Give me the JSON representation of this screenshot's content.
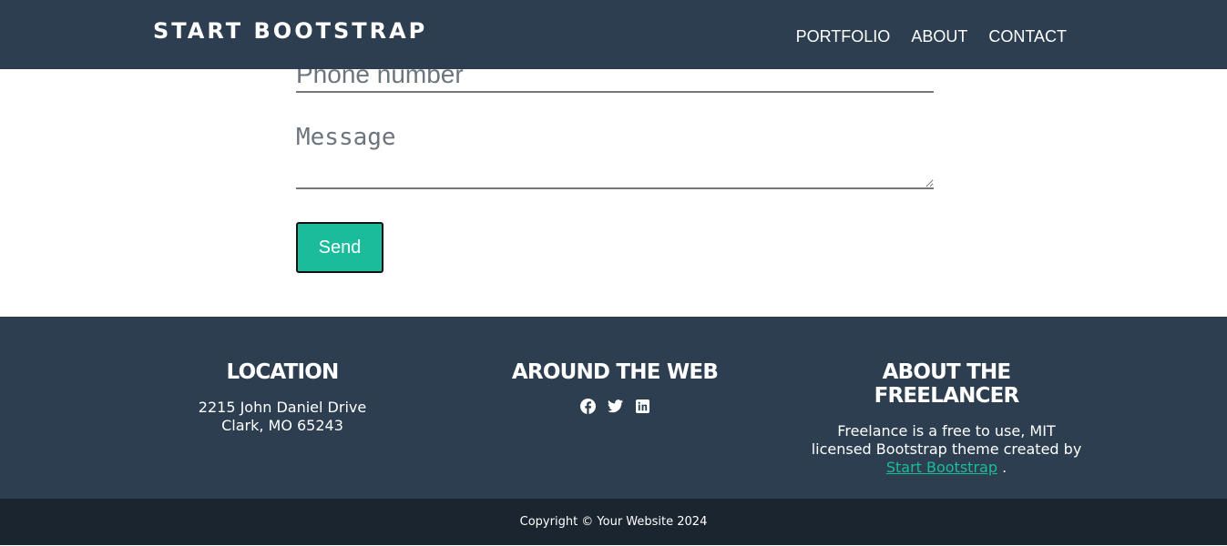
{
  "navbar": {
    "brand": "START BOOTSTRAP",
    "links": [
      "PORTFOLIO",
      "ABOUT",
      "CONTACT"
    ]
  },
  "form": {
    "phone_placeholder": "Phone number",
    "message_placeholder": "Message",
    "send_label": "Send"
  },
  "footer": {
    "location": {
      "heading": "LOCATION",
      "line1": "2215 John Daniel Drive",
      "line2": "Clark, MO 65243"
    },
    "web": {
      "heading": "AROUND THE WEB",
      "icons": [
        "facebook-icon",
        "twitter-icon",
        "linkedin-icon"
      ]
    },
    "about": {
      "heading": "ABOUT THE FREELANCER",
      "text_before": "Freelance is a free to use, MIT licensed Bootstrap theme created by ",
      "link": "Start Bootstrap",
      "text_after": " ."
    }
  },
  "copyright": "Copyright © Your Website 2024",
  "colors": {
    "primary": "#2c3e50",
    "accent": "#1abc9c",
    "dark": "#1a252f"
  }
}
